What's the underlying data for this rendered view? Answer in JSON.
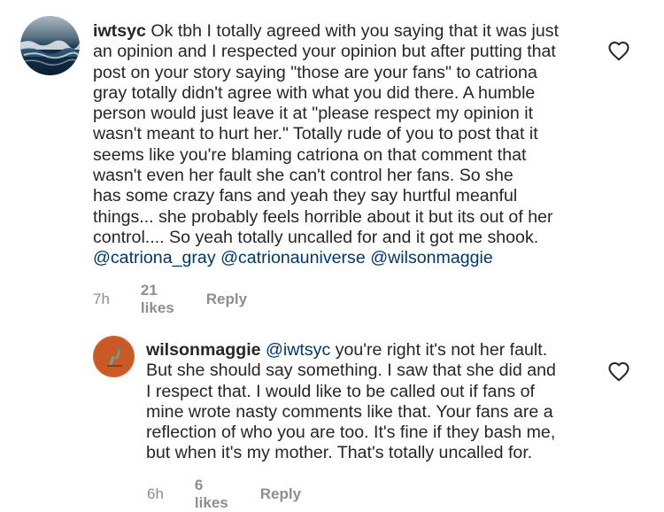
{
  "comments": [
    {
      "username": "iwtsyc",
      "lines": [
        "Ok tbh I totally agreed with you saying that it was just",
        "an opinion and I respected your opinion but after putting that",
        "post on your story saying \"those are your fans\" to catriona",
        "gray totally didn't agree with what you did there. A humble",
        "person would just leave it at \"please respect my opinion it",
        "wasn't meant to hurt her.\" Totally rude of you to post that it",
        "seems like you're blaming catriona on that comment that",
        "wasn't even her fault she can't control her fans. So she",
        "has some crazy fans and yeah they say hurtful meanful",
        "things... she probably feels horrible about it but its out of her",
        "control.... So yeah totally uncalled for and it got me shook."
      ],
      "mentions": [
        "@catriona_gray",
        "@catrionauniverse",
        "@wilsonmaggie"
      ],
      "time": "7h",
      "likes": "21 likes",
      "reply": "Reply",
      "avatar_icon": "ocean-wave-avatar",
      "heart_icon": "heart-outline-icon"
    },
    {
      "username": "wilsonmaggie",
      "mention": "@iwtsyc",
      "first_line_rest": "you're right it's not her fault.",
      "lines": [
        "But she should say something. I saw that she did and",
        "I respect that. I would like to be called out if fans of",
        "mine wrote nasty comments like that. Your fans are a",
        "reflection of who you are too. It's fine if they bash me,",
        "but when it's my mother. That's totally uncalled for."
      ],
      "time": "6h",
      "likes": "6 likes",
      "reply": "Reply",
      "avatar_icon": "orange-profile-avatar",
      "heart_icon": "heart-outline-icon"
    }
  ],
  "colors": {
    "text": "#262626",
    "mention": "#00376b",
    "meta": "#8e8e8e"
  }
}
